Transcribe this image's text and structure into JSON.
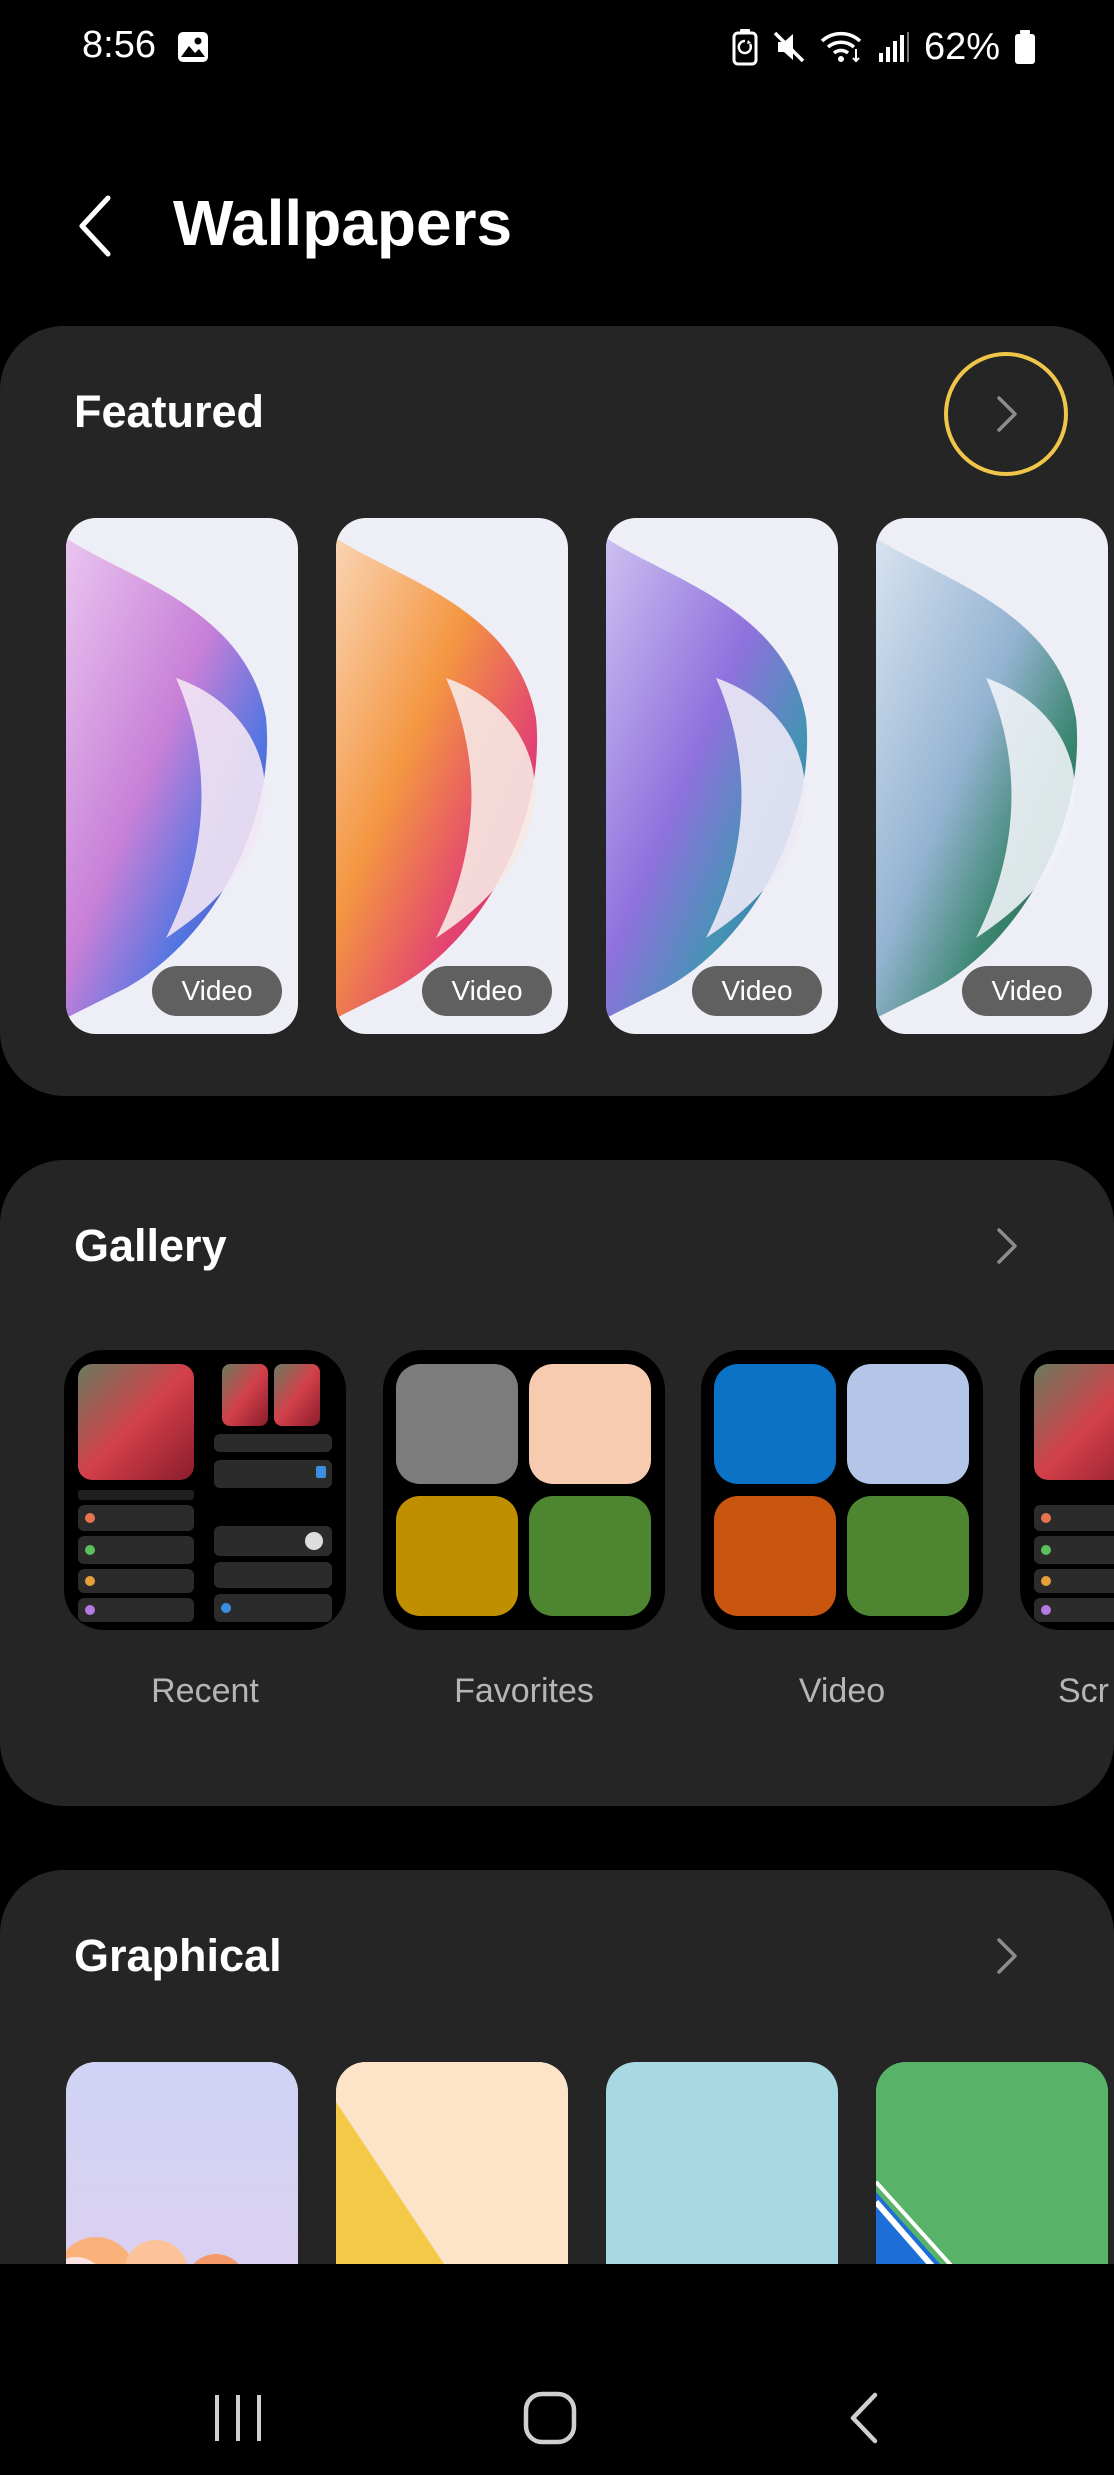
{
  "status_bar": {
    "time": "8:56",
    "gallery_notification_icon": "image-icon",
    "icons": [
      "battery-saver-icon",
      "mute-icon",
      "wifi-icon",
      "signal-icon",
      "battery-icon"
    ],
    "battery_percent": "62%"
  },
  "header": {
    "back_icon": "chevron-left-icon",
    "title": "Wallpapers"
  },
  "featured": {
    "title": "Featured",
    "more_icon": "chevron-right-icon",
    "items": [
      {
        "badge": "Video",
        "palette": [
          "#c67ad6",
          "#4a6fe0",
          "#5b2f9e"
        ]
      },
      {
        "badge": "Video",
        "palette": [
          "#f49238",
          "#e23a6a",
          "#b81d4f"
        ]
      },
      {
        "badge": "Video",
        "palette": [
          "#8a6bdc",
          "#3a8fb0",
          "#2f3ea8"
        ]
      },
      {
        "badge": "Video",
        "palette": [
          "#8fb0cf",
          "#2f7f66",
          "#1d3d35"
        ]
      }
    ]
  },
  "gallery": {
    "title": "Gallery",
    "more_icon": "chevron-right-icon",
    "albums": [
      {
        "label": "Recent"
      },
      {
        "label": "Favorites",
        "swatches": [
          "#7c7c7c",
          "#f7cbb0",
          "#c08f00",
          "#4d8530"
        ]
      },
      {
        "label": "Video",
        "swatches": [
          "#0b72c6",
          "#b4c6e8",
          "#c8560f",
          "#4d8530"
        ]
      },
      {
        "label": "Scr"
      }
    ]
  },
  "graphical": {
    "title": "Graphical",
    "more_icon": "chevron-right-icon",
    "colors": [
      "#c8cdf2",
      "#fde3c8",
      "#a8d8e2",
      "#58b369"
    ]
  },
  "nav_bar": {
    "icons": [
      "recent-apps-icon",
      "home-icon",
      "back-icon"
    ]
  },
  "colors": {
    "background": "#000000",
    "card": "#252525",
    "focus_ring": "#f0c64a",
    "label": "#b5b5b5"
  }
}
